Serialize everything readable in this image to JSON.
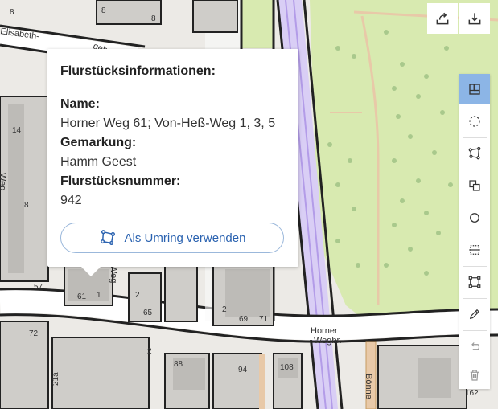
{
  "map": {
    "street_labels": [
      "Elisabeth-",
      "gehe",
      "Weg",
      "Weg",
      "Horner",
      "Wegbr.",
      "Bönne"
    ],
    "house_numbers": [
      "8",
      "8",
      "8",
      "14",
      "8",
      "57",
      "61",
      "1",
      "2",
      "65",
      "2",
      "69",
      "71",
      "72",
      "88",
      "94",
      "108",
      "2",
      "21a",
      "162"
    ]
  },
  "popup": {
    "title": "Flurstücksinformationen:",
    "name_label": "Name:",
    "name_value": "Horner Weg 61; Von-Heß-Weg 1, 3, 5",
    "gemarkung_label": "Gemarkung:",
    "gemarkung_value": "Hamm Geest",
    "nummer_label": "Flurstücksnummer:",
    "nummer_value": "942",
    "button_label": "Als Umring verwenden",
    "button_icon": "polygon-icon"
  },
  "top_buttons": [
    {
      "icon": "share-icon"
    },
    {
      "icon": "download-icon"
    }
  ],
  "toolbar": [
    {
      "icon": "parcel-select-icon",
      "active": true
    },
    {
      "icon": "dashed-circle-icon",
      "active": false
    },
    {
      "icon": "polygon-draw-icon",
      "active": false
    },
    {
      "icon": "copy-icon",
      "active": false
    },
    {
      "icon": "circle-icon",
      "active": false
    },
    {
      "icon": "rectangle-line-icon",
      "active": false
    },
    {
      "icon": "square-draw-icon",
      "active": false
    },
    {
      "icon": "pencil-icon",
      "active": false
    },
    {
      "icon": "undo-icon",
      "active": false
    },
    {
      "icon": "trash-icon",
      "active": false
    }
  ],
  "colors": {
    "accent": "#2a62b0",
    "active_tool": "#8cb5e6",
    "green_area": "#d8eab0",
    "rail": "#c8b7ee"
  }
}
